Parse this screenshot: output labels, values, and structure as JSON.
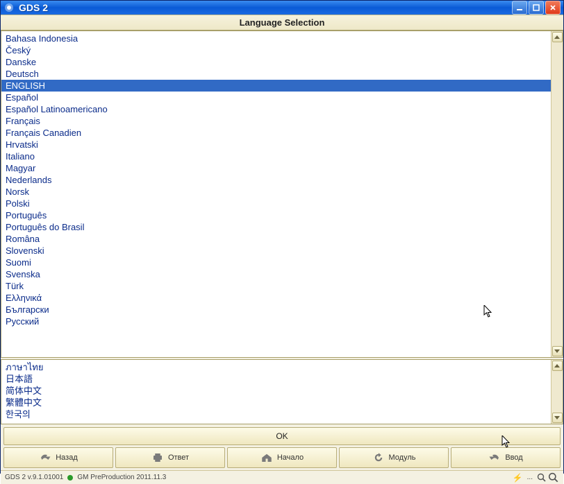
{
  "window": {
    "title": "GDS 2"
  },
  "header": {
    "title": "Language Selection"
  },
  "languages_top": [
    "Bahasa Indonesia",
    "Český",
    "Danske",
    "Deutsch",
    "ENGLISH",
    "Español",
    "Español Latinoamericano",
    "Français",
    "Français Canadien",
    "Hrvatski",
    "Italiano",
    "Magyar",
    "Nederlands",
    "Norsk",
    "Polski",
    "Português",
    "Português do Brasil",
    "Româna",
    "Slovenski",
    "Suomi",
    "Svenska",
    "Türk",
    "Ελληνικά",
    "Български",
    "Русский"
  ],
  "selected_index": 4,
  "languages_bottom": [
    "ภาษาไทย",
    "日本語",
    "简体中文",
    "繁體中文",
    "한국의"
  ],
  "buttons": {
    "ok": "OK",
    "back": "Назад",
    "answer": "Ответ",
    "start": "Начало",
    "module": "Модуль",
    "input": "Ввод"
  },
  "status": {
    "version": "GDS 2 v.9.1.01001",
    "pre": "GM PreProduction 2011.11.3",
    "dots": "..."
  }
}
